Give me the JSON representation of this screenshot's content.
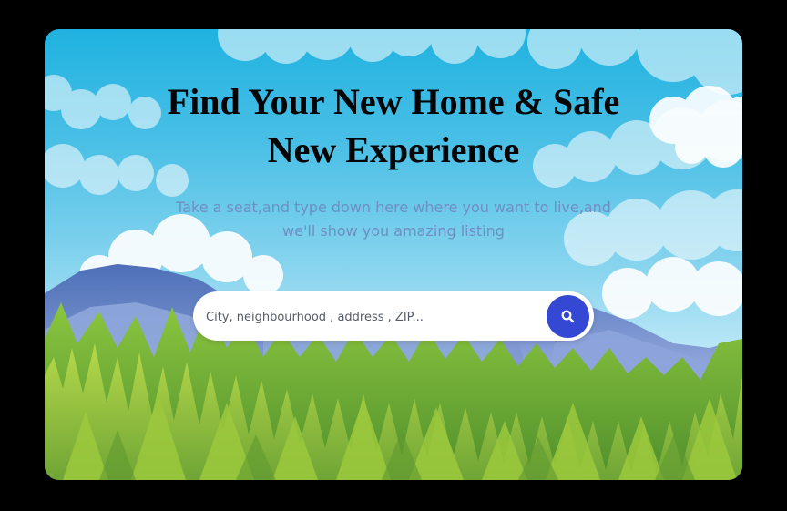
{
  "hero": {
    "headline_line1": "Find Your New Home & Safe",
    "headline_line2": "New Experience",
    "subtext_line1": "Take a seat,and type down here where you want to live,and",
    "subtext_line2": "we'll show you amazing listing"
  },
  "search": {
    "placeholder": "City, neighbourhood , address , ZIP...",
    "value": "",
    "button_icon": "search-icon"
  },
  "colors": {
    "sky_top": "#1fb2e0",
    "button": "#3548d3",
    "subtext": "#6f8ec2",
    "forest": "#7fb93a"
  }
}
